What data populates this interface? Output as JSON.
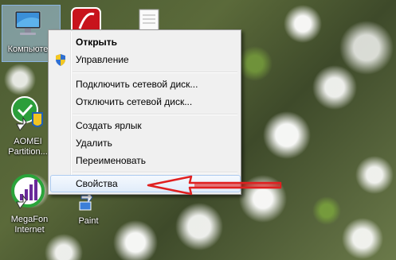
{
  "desktop": {
    "icons": [
      {
        "label": "Компьюте"
      },
      {
        "label": "AOMEI Partition..."
      },
      {
        "label": "MegaFon Internet"
      },
      {
        "label": "Paint"
      }
    ]
  },
  "context_menu": {
    "items": [
      {
        "label": "Открыть",
        "bold": true
      },
      {
        "label": "Управление",
        "icon": "uac-shield-icon"
      },
      {
        "label": "Подключить сетевой диск..."
      },
      {
        "label": "Отключить сетевой диск..."
      },
      {
        "label": "Создать ярлык"
      },
      {
        "label": "Удалить"
      },
      {
        "label": "Переименовать"
      },
      {
        "label": "Свойства",
        "highlighted": true
      }
    ]
  },
  "colors": {
    "menu_bg": "#f0f0f0",
    "highlight": "#e1ecfa",
    "annotation_arrow": "#e02020"
  }
}
